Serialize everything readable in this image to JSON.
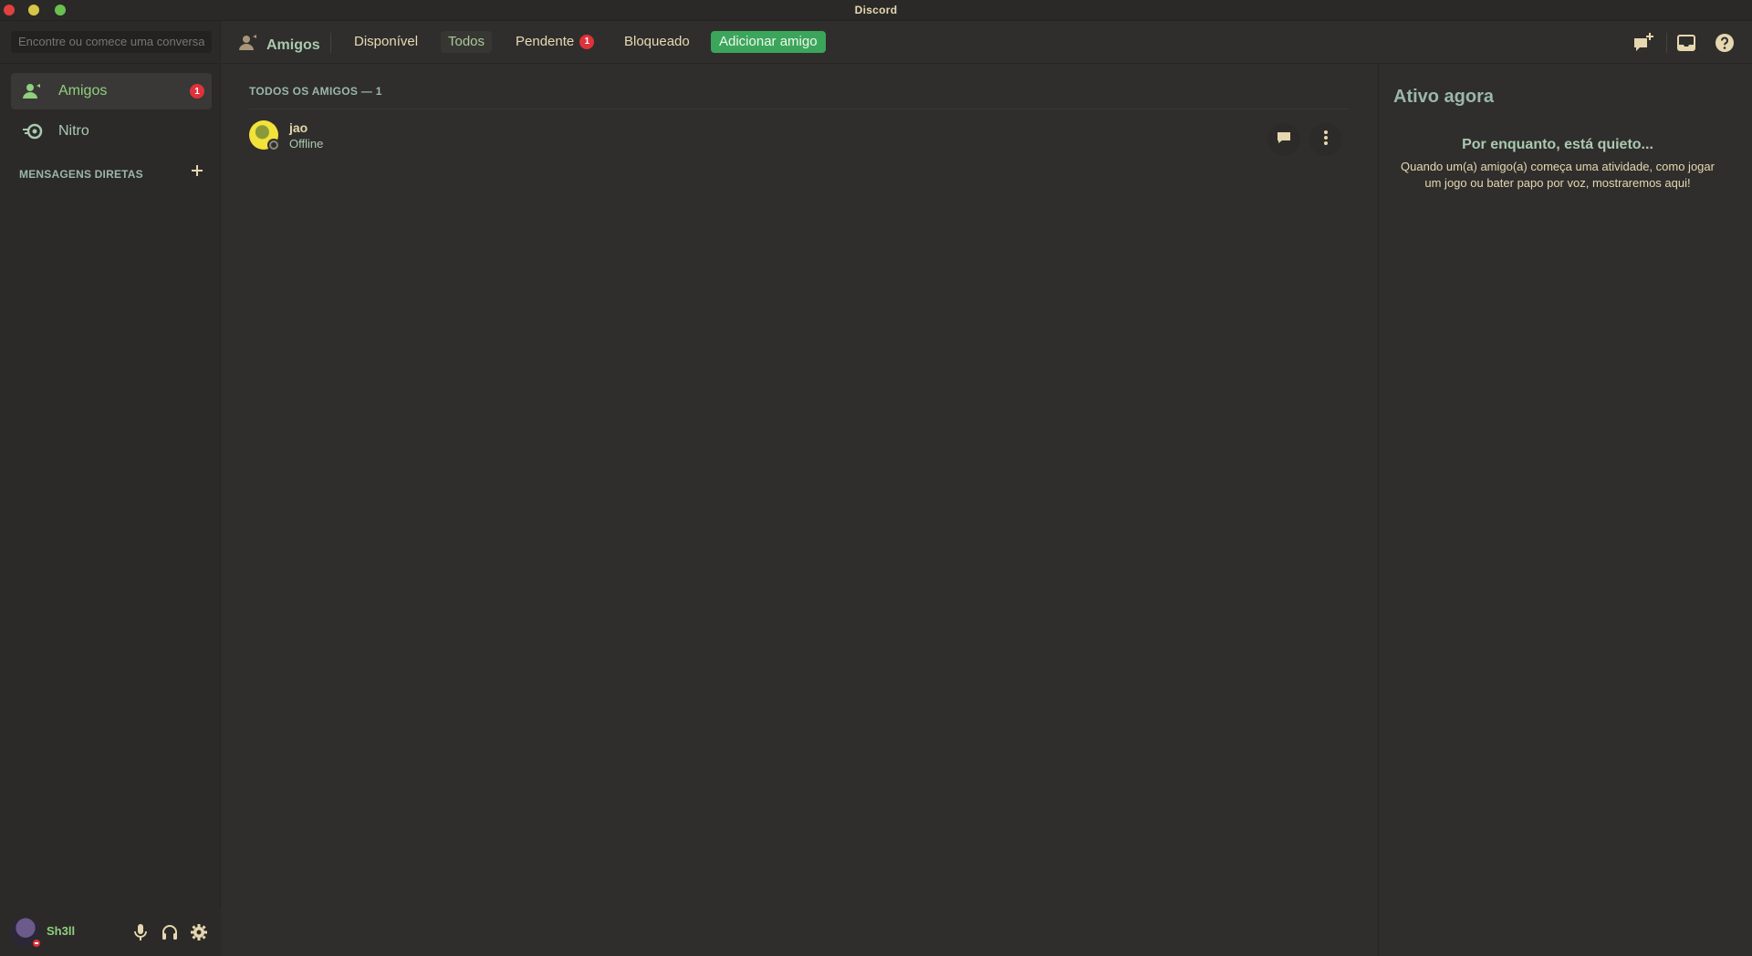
{
  "window": {
    "title": "Discord"
  },
  "sidebar": {
    "search_placeholder": "Encontre ou comece uma conversa",
    "items": [
      {
        "label": "Amigos",
        "badge": "1",
        "icon": "friends-icon"
      },
      {
        "label": "Nitro",
        "icon": "nitro-icon"
      }
    ],
    "dm_header": "MENSAGENS DIRETAS"
  },
  "user": {
    "name": "Sh3ll",
    "status": "dnd"
  },
  "header": {
    "title": "Amigos",
    "tabs": [
      {
        "label": "Disponível"
      },
      {
        "label": "Todos"
      },
      {
        "label": "Pendente",
        "badge": "1"
      },
      {
        "label": "Bloqueado"
      },
      {
        "label": "Adicionar amigo"
      }
    ],
    "active_tab": "Todos"
  },
  "friends": {
    "title": "TODOS OS AMIGOS — 1",
    "list": [
      {
        "name": "jao",
        "status": "Offline"
      }
    ]
  },
  "active_now": {
    "title": "Ativo agora",
    "empty_title": "Por enquanto, está quieto...",
    "empty_body": "Quando um(a) amigo(a) começa uma atividade, como jogar um jogo ou bater papo por voz, mostraremos aqui!"
  },
  "colors": {
    "background": "#2f2e2c",
    "sidebar": "#2b2a28",
    "accent_green": "#3ba55c",
    "badge_red": "#e0323a",
    "text_main": "#e6d7b0",
    "text_muted": "#9bb7a8"
  }
}
